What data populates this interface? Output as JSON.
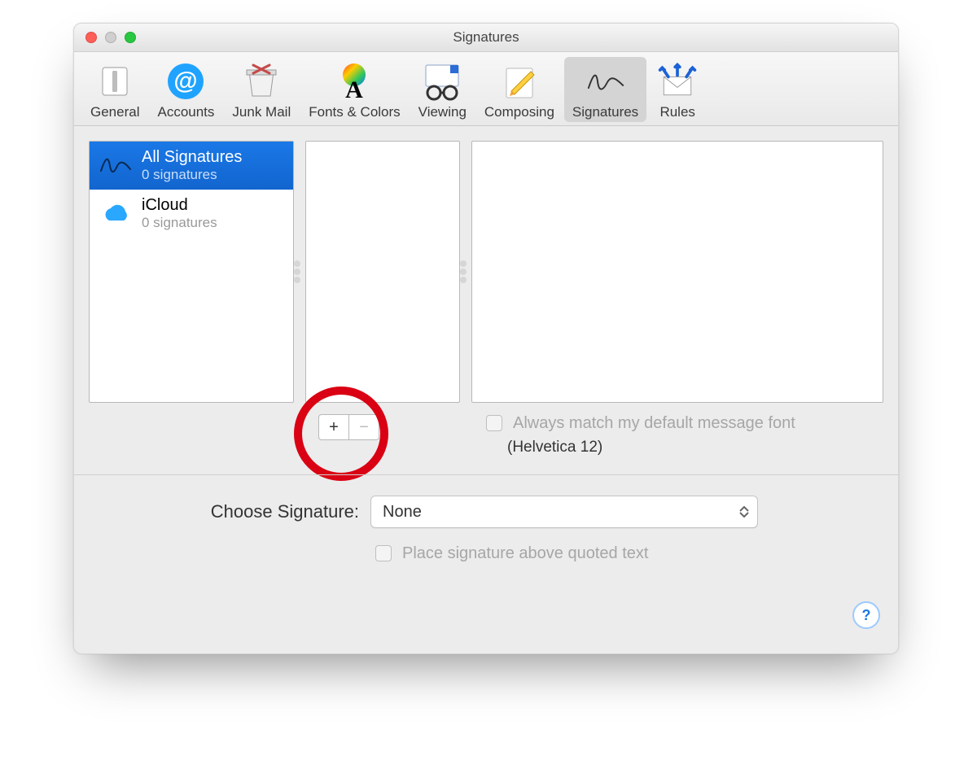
{
  "window": {
    "title": "Signatures"
  },
  "toolbar": {
    "items": [
      {
        "label": "General"
      },
      {
        "label": "Accounts"
      },
      {
        "label": "Junk Mail"
      },
      {
        "label": "Fonts & Colors"
      },
      {
        "label": "Viewing"
      },
      {
        "label": "Composing"
      },
      {
        "label": "Signatures"
      },
      {
        "label": "Rules"
      }
    ],
    "selected_index": 6
  },
  "accounts": [
    {
      "title": "All Signatures",
      "subtitle": "0 signatures",
      "selected": true
    },
    {
      "title": "iCloud",
      "subtitle": "0 signatures",
      "selected": false
    }
  ],
  "buttons": {
    "add": "+",
    "remove": "−"
  },
  "match_font": {
    "label": "Always match my default message font",
    "font_note": "(Helvetica 12)",
    "checked": false,
    "enabled": false
  },
  "choose_signature": {
    "label": "Choose Signature:",
    "value": "None"
  },
  "place_above": {
    "label": "Place signature above quoted text",
    "checked": false,
    "enabled": false
  },
  "help": {
    "glyph": "?"
  }
}
